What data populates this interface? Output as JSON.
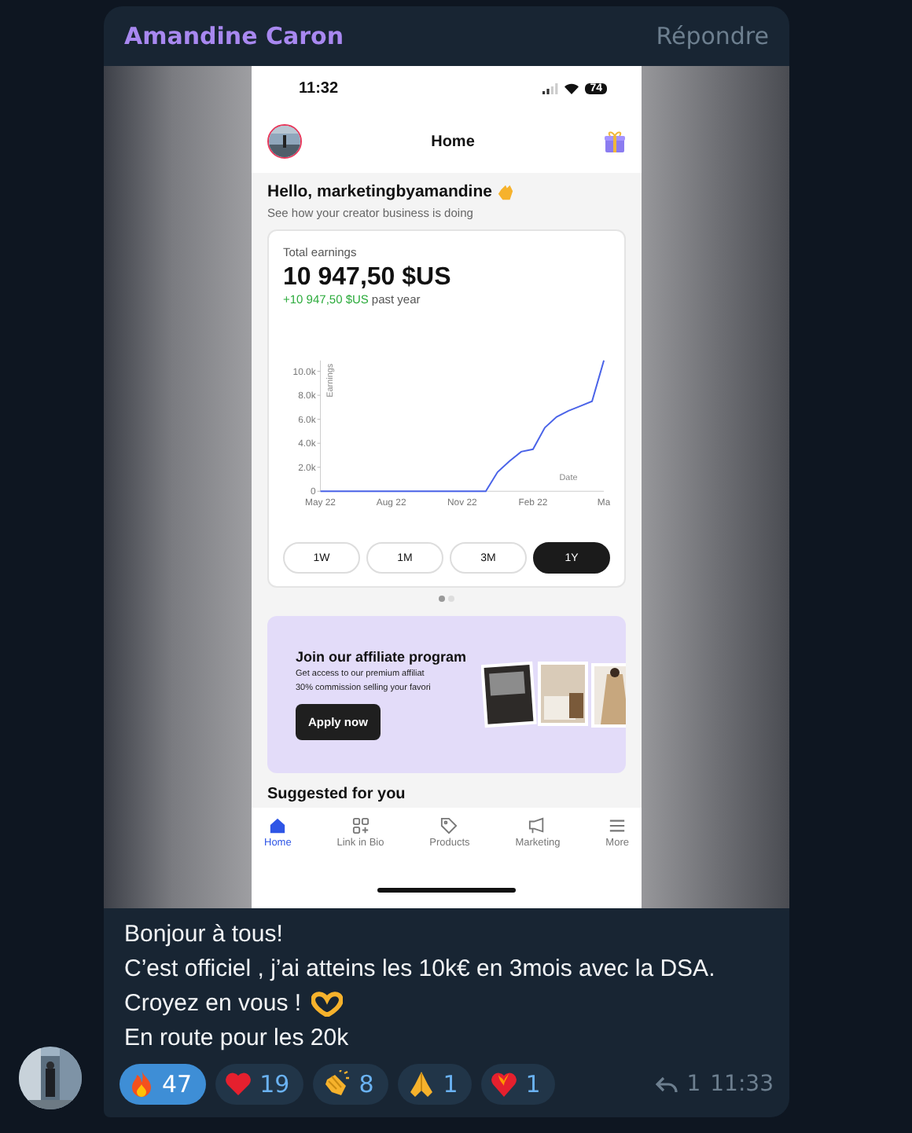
{
  "message": {
    "sender": "Amandine Caron",
    "reply_action": "Répondre",
    "phone": {
      "status_bar": {
        "time": "11:32",
        "battery": "74"
      },
      "header": {
        "title": "Home"
      },
      "greeting": {
        "title": "Hello, marketingbyamandine",
        "subtitle": "See how your creator business is doing"
      },
      "earnings_card": {
        "label": "Total earnings",
        "amount": "10 947,50 $US",
        "change_amount": "+10 947,50 $US",
        "change_label": "past year",
        "chart_data": {
          "type": "line",
          "xlabel": "Date",
          "ylabel": "Earnings",
          "categories": [
            "May 22",
            null,
            null,
            null,
            null,
            null,
            "Aug 22",
            null,
            null,
            null,
            null,
            null,
            "Nov 22",
            null,
            null,
            null,
            null,
            null,
            "Feb 22",
            null,
            null,
            null,
            null,
            null,
            "Ma"
          ],
          "series": [
            {
              "color": "#4a63e8",
              "values": [
                0,
                0,
                0,
                0,
                0,
                0,
                0,
                0,
                0,
                0,
                0,
                0,
                0,
                0,
                0,
                1600,
                2500,
                3300,
                3500,
                5300,
                6200,
                6700,
                7100,
                7500,
                10900
              ]
            }
          ],
          "ylim": [
            0,
            10900
          ],
          "yticks": [
            {
              "value": 0,
              "label": "0"
            },
            {
              "value": 2000,
              "label": "2.0k"
            },
            {
              "value": 4000,
              "label": "4.0k"
            },
            {
              "value": 6000,
              "label": "6.0k"
            },
            {
              "value": 8000,
              "label": "8.0k"
            },
            {
              "value": 10000,
              "label": "10.0k"
            }
          ]
        },
        "ranges": [
          {
            "label": "1W",
            "selected": false
          },
          {
            "label": "1M",
            "selected": false
          },
          {
            "label": "3M",
            "selected": false
          },
          {
            "label": "1Y",
            "selected": true
          }
        ]
      },
      "pager": [
        {
          "selected": true
        },
        {
          "selected": false
        }
      ],
      "affiliate_banner": {
        "title": "Join our affiliate program",
        "lines": [
          "Get access to our premium affiliat",
          "30% commission selling your favori"
        ],
        "button": "Apply now",
        "kind": "picture"
      },
      "section_title": "Suggested for you",
      "nav": [
        {
          "kind": "home",
          "label": "Home",
          "selected": true
        },
        {
          "kind": "links",
          "label": "Link in Bio",
          "selected": false
        },
        {
          "kind": "tag",
          "label": "Products",
          "selected": false
        },
        {
          "kind": "megaphone",
          "label": "Marketing",
          "selected": false
        },
        {
          "kind": "menu",
          "label": "More",
          "selected": false
        }
      ]
    },
    "text_lines": [
      "Bonjour à tous!",
      "C’est officiel , j’ai atteins les 10k€ en 3mois avec la DSA.",
      "Croyez en vous !",
      "En route pour les 20k"
    ],
    "reactions": [
      {
        "kind": "fire",
        "count": "47",
        "selected": true
      },
      {
        "kind": "heart",
        "count": "19",
        "selected": false
      },
      {
        "kind": "clap",
        "count": "8",
        "selected": false
      },
      {
        "kind": "pray",
        "count": "1",
        "selected": false
      },
      {
        "kind": "heart_fire",
        "count": "1",
        "selected": false
      }
    ],
    "replies": "1",
    "time": "11:33"
  }
}
